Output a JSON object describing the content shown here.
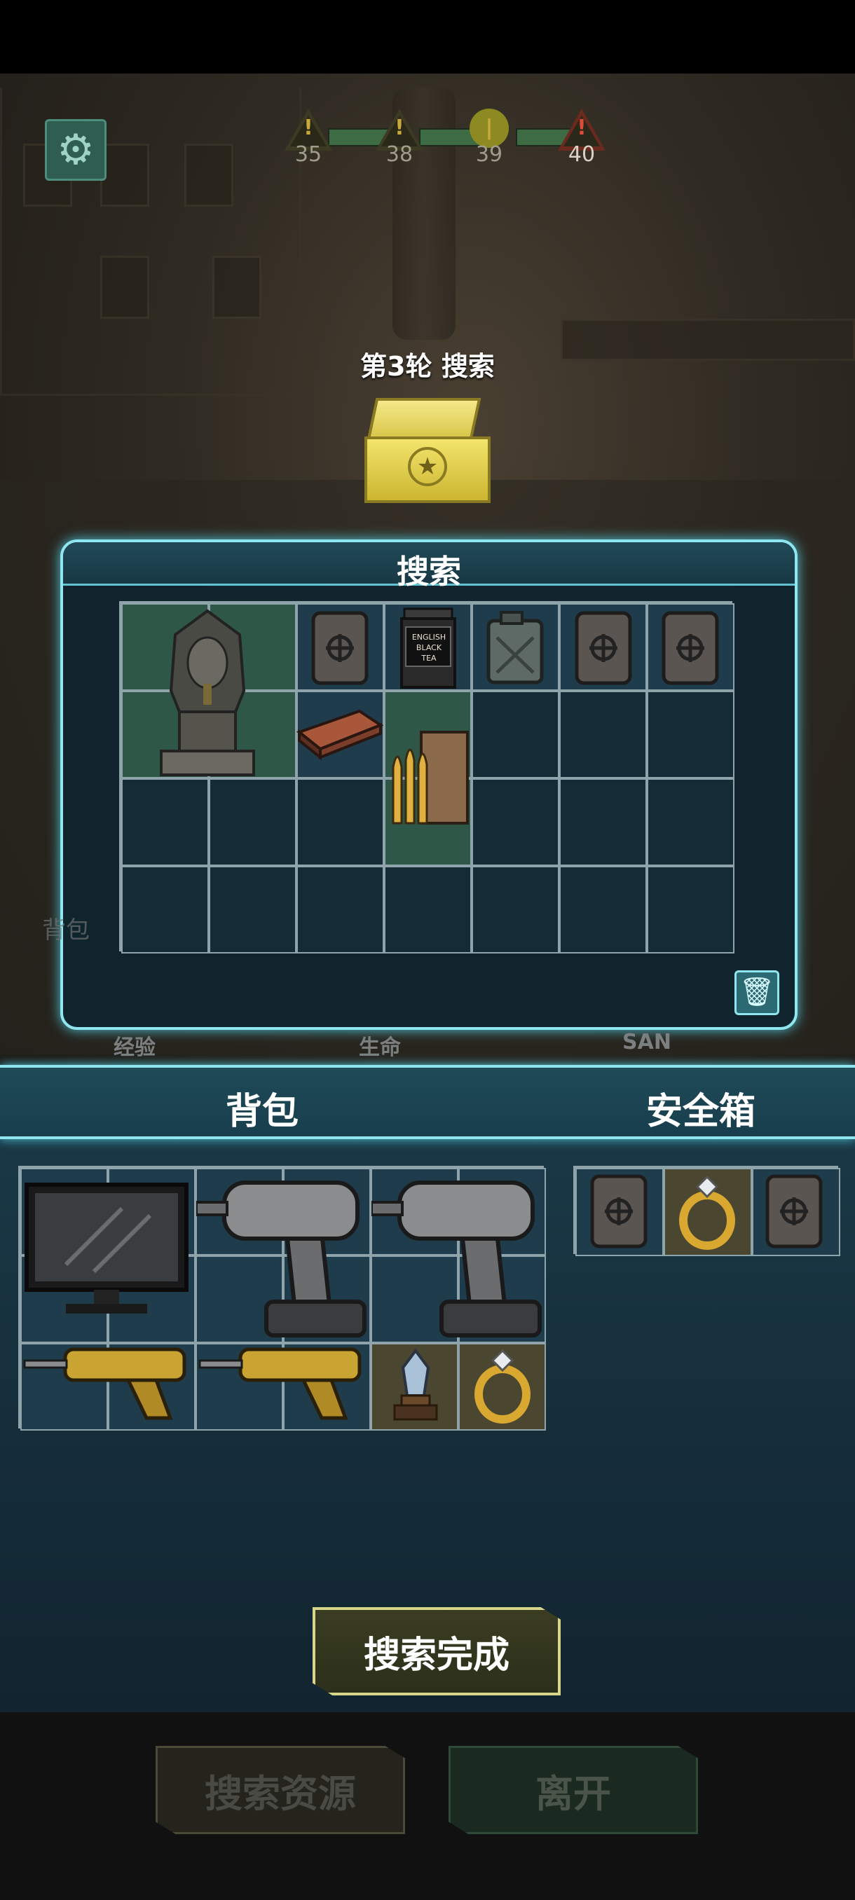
{
  "threat": {
    "nodes": [
      {
        "level": "35",
        "kind": "warning"
      },
      {
        "level": "38",
        "kind": "warning"
      },
      {
        "level": "39",
        "kind": "current"
      },
      {
        "level": "40",
        "kind": "danger"
      }
    ]
  },
  "round": {
    "title": "第3轮 搜索"
  },
  "search_panel": {
    "title": "搜索",
    "items": [
      {
        "name": "pharaoh-sphinx-statue-icon"
      },
      {
        "name": "rune-stone-tablet-icon"
      },
      {
        "name": "tea-tin-icon",
        "label": "ENGLISH BLACK TEA"
      },
      {
        "name": "jerry-can-icon"
      },
      {
        "name": "rune-stone-tablet-icon"
      },
      {
        "name": "rune-stone-tablet-icon"
      },
      {
        "name": "matchbox-icon"
      },
      {
        "name": "rifle-bullets-icon"
      }
    ]
  },
  "hud": {
    "exp": "经验",
    "life": "生命",
    "san": "SAN",
    "bag_ghost": "背包"
  },
  "inventory": {
    "backpack_label": "背包",
    "safebox_label": "安全箱",
    "backpack_items": [
      {
        "name": "monitor-icon"
      },
      {
        "name": "power-drill-icon"
      },
      {
        "name": "power-drill-icon"
      },
      {
        "name": "gold-drill-icon"
      },
      {
        "name": "gold-drill-icon"
      },
      {
        "name": "crystal-trophy-icon"
      },
      {
        "name": "diamond-ring-icon"
      }
    ],
    "safebox_items": [
      {
        "name": "rune-stone-tablet-icon"
      },
      {
        "name": "diamond-ring-icon"
      },
      {
        "name": "rune-stone-tablet-icon"
      }
    ]
  },
  "buttons": {
    "done": "搜索完成",
    "search_resources": "搜索资源",
    "leave": "离开"
  },
  "icons": {
    "settings": "gear-icon",
    "trash": "trash-icon"
  },
  "colors": {
    "accent": "#8fe6f0",
    "cell_green": "#2f5748",
    "cell_gold": "#4b4630",
    "danger": "#e04a3a"
  }
}
